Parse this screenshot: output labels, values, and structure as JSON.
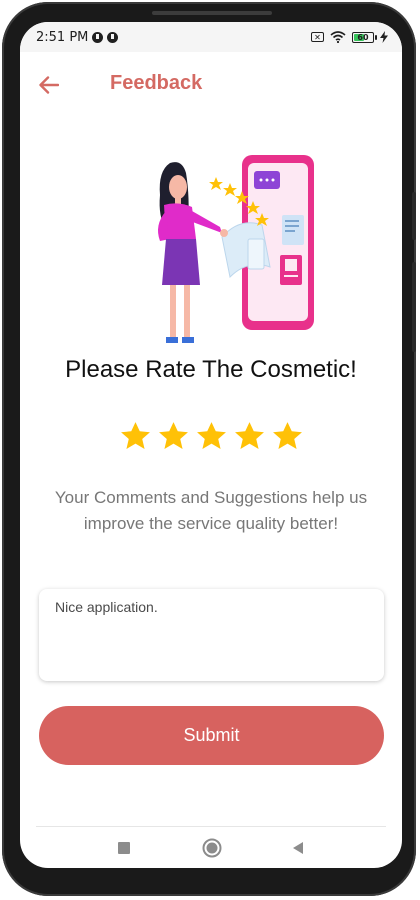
{
  "status_bar": {
    "time": "2:51 PM",
    "battery_level": "60"
  },
  "app_bar": {
    "title": "Feedback",
    "back_icon": "arrow-left-icon"
  },
  "main": {
    "heading": "Please Rate The Cosmetic!",
    "rating": {
      "value": 5,
      "max": 5
    },
    "description": "Your Comments and Suggestions help us improve the service quality better!",
    "comment_value": "Nice application.",
    "submit_label": "Submit"
  },
  "nav_bar": {
    "icons": [
      "square-icon",
      "home-circle-icon",
      "back-triangle-icon"
    ]
  },
  "colors": {
    "accent": "#d7625f",
    "title": "#d46a63",
    "star": "#ffc107",
    "text_muted": "#777777"
  }
}
